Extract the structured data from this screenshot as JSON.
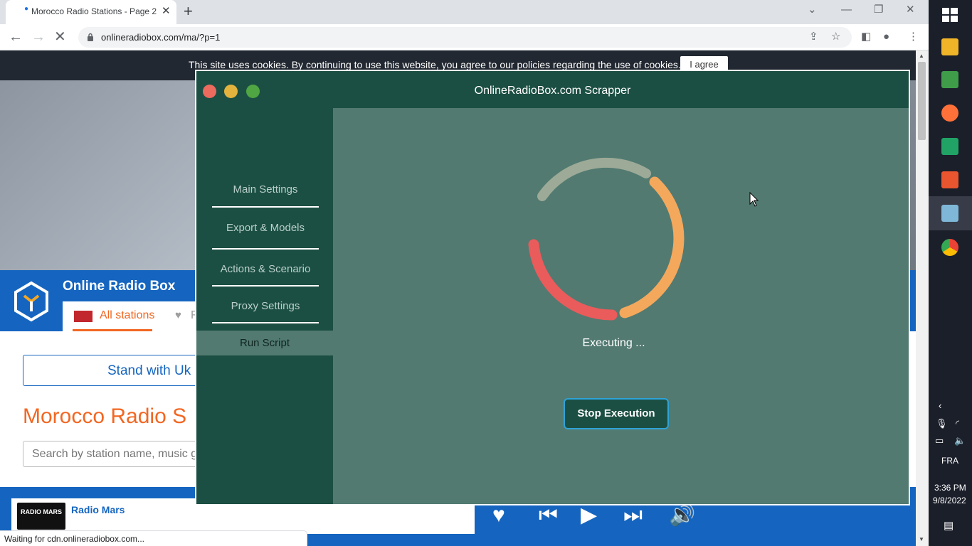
{
  "browser": {
    "tab_title": "Morocco Radio Stations - Page 2",
    "url": "onlineradiobox.com/ma/?p=1",
    "status_text": "Waiting for cdn.onlineradiobox.com..."
  },
  "website": {
    "cookie_text": "This site uses cookies. By continuing to use this website, you agree to our policies regarding the use of cookies.",
    "cookie_button": "I agree",
    "brand_name": "Online Radio Box",
    "all_stations_tab": "All stations",
    "favorites_tab_partial": "F",
    "ukraine_banner": "Stand with Uk",
    "page_heading": "Morocco Radio S",
    "search_placeholder": "Search by station name, music g",
    "player": {
      "station_name": "Radio Mars",
      "logo_text": "RADIO MARS"
    }
  },
  "app": {
    "title": "OnlineRadioBox.com Scrapper",
    "sidebar": [
      {
        "label": "Main Settings",
        "active": false
      },
      {
        "label": "Export & Models",
        "active": false
      },
      {
        "label": "Actions & Scenario",
        "active": false
      },
      {
        "label": "Proxy Settings",
        "active": false
      },
      {
        "label": "Run Script",
        "active": true
      }
    ],
    "status_label": "Executing ...",
    "stop_button": "Stop Execution",
    "colors": {
      "window_bg": "#1c4f43",
      "content_bg": "#527a71",
      "close": "#ed6a5e",
      "minimize": "#e3b33d",
      "maximize": "#4fa642",
      "button_border": "#2ea3d6"
    }
  },
  "taskbar": {
    "language": "FRA",
    "time": "3:36 PM",
    "date": "9/8/2022"
  }
}
